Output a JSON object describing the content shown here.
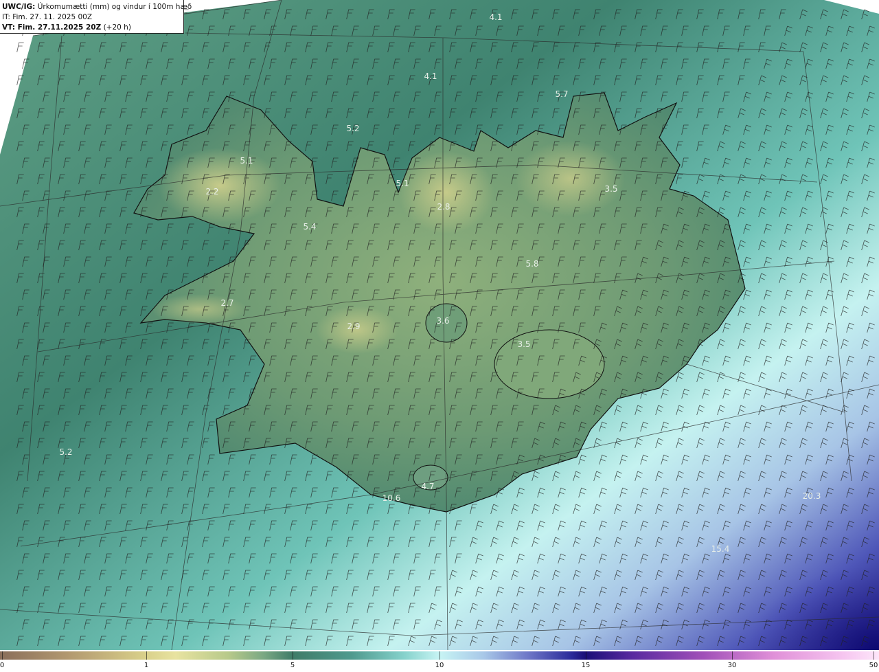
{
  "header": {
    "source": "UWC/IG:",
    "title": "Úrkomumætti (mm) og vindur í 100m hæð",
    "init_time": "IT: Fim. 27. 11. 2025 00Z",
    "valid_label": "VT: Fim. 27.11.2025 20Z",
    "lead_time": "(+20 h)"
  },
  "map_values": [
    {
      "text": "4.1"
    },
    {
      "text": "4.1"
    },
    {
      "text": "5.7"
    },
    {
      "text": "5.2"
    },
    {
      "text": "5.1"
    },
    {
      "text": "5.1"
    },
    {
      "text": "2.2"
    },
    {
      "text": "3.5"
    },
    {
      "text": "2.8"
    },
    {
      "text": "5.4"
    },
    {
      "text": "5.8"
    },
    {
      "text": "2.7"
    },
    {
      "text": "3.6"
    },
    {
      "text": "2.9"
    },
    {
      "text": "3.5"
    },
    {
      "text": "5.2"
    },
    {
      "text": "4.7"
    },
    {
      "text": "10.6"
    },
    {
      "text": "20.3"
    },
    {
      "text": "15.4"
    }
  ],
  "colorbar": {
    "ticks": [
      {
        "label": "0",
        "pos": 0
      },
      {
        "label": "1",
        "pos": 1
      },
      {
        "label": "5",
        "pos": 2
      },
      {
        "label": "10",
        "pos": 3
      },
      {
        "label": "15",
        "pos": 4
      },
      {
        "label": "30",
        "pos": 5
      },
      {
        "label": "50",
        "pos": 6
      }
    ]
  },
  "colors": {
    "land_low": "#3f7c68",
    "land_high": "#e3dd98",
    "sea": "#6aa995",
    "heavy_precip": "#1a0f78",
    "coastline": "#111111",
    "wind_barb": "#222222"
  }
}
